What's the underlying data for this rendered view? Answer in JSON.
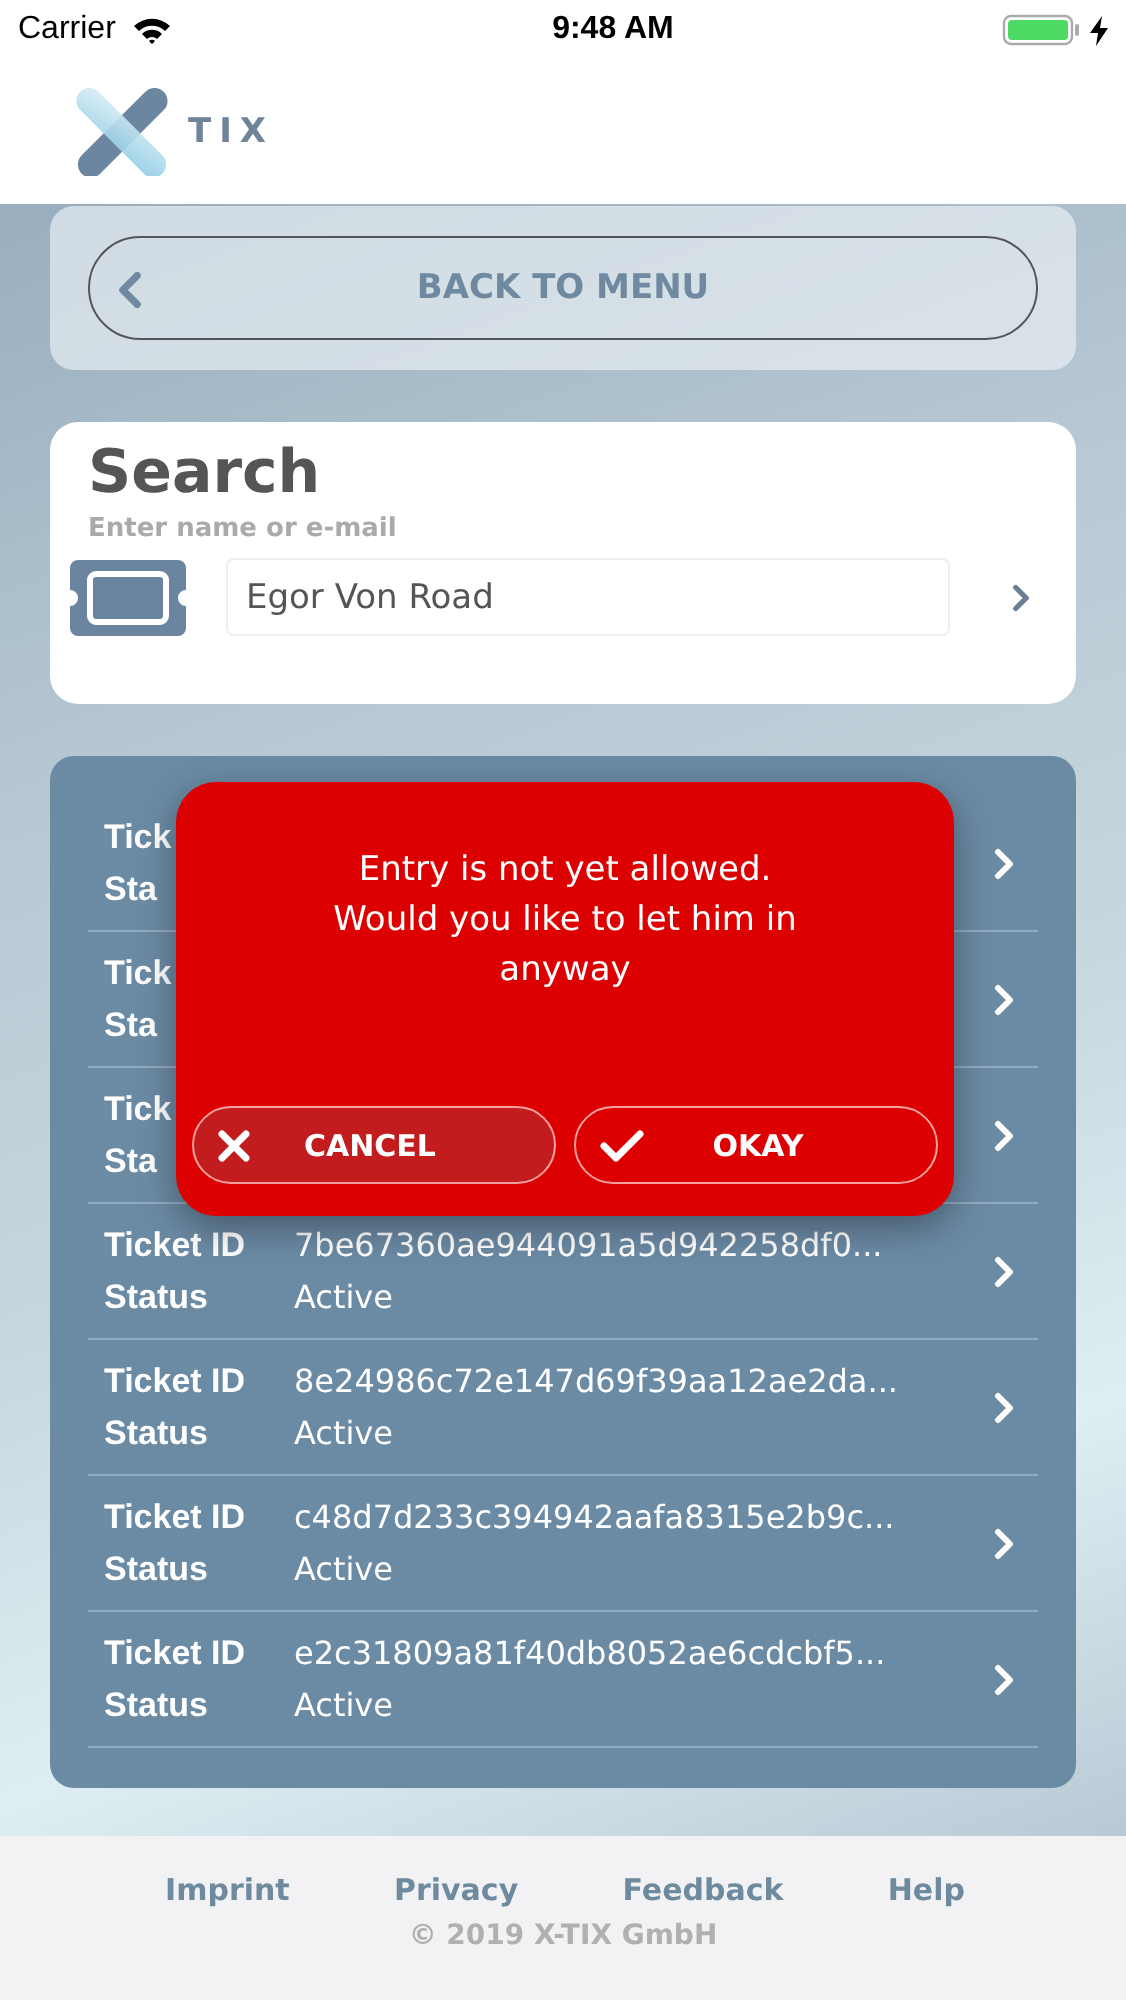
{
  "status_bar": {
    "carrier": "Carrier",
    "time": "9:48 AM"
  },
  "header": {
    "logo_text": "TIX"
  },
  "back_button": {
    "label": "BACK TO MENU"
  },
  "search": {
    "title": "Search",
    "subtitle": "Enter name or e-mail",
    "value": "Egor Von Road"
  },
  "tickets": [
    {
      "id_label": "Tick",
      "status_label": "Sta"
    },
    {
      "id_label": "Tick",
      "status_label": "Sta"
    },
    {
      "id_label": "Tick",
      "status_label": "Sta"
    },
    {
      "id_label": "Ticket ID",
      "id": "7be67360ae944091a5d942258df0...",
      "status_label": "Status",
      "status": "Active"
    },
    {
      "id_label": "Ticket ID",
      "id": "8e24986c72e147d69f39aa12ae2da...",
      "status_label": "Status",
      "status": "Active"
    },
    {
      "id_label": "Ticket ID",
      "id": "c48d7d233c394942aafa8315e2b9c...",
      "status_label": "Status",
      "status": "Active"
    },
    {
      "id_label": "Ticket ID",
      "id": "e2c31809a81f40db8052ae6cdcbf5...",
      "status_label": "Status",
      "status": "Active"
    }
  ],
  "dialog": {
    "message": "Entry is not yet allowed. Would you like to let him in anyway",
    "buttons": [
      {
        "kind": "cancel",
        "label": "CANCEL",
        "selected": true
      },
      {
        "kind": "confirm",
        "label": "OKAY",
        "selected": false
      }
    ]
  },
  "footer": {
    "links": [
      "Imprint",
      "Privacy",
      "Feedback",
      "Help"
    ],
    "copyright": "© 2019 X-TIX GmbH"
  }
}
